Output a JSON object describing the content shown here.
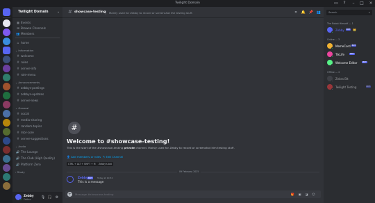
{
  "app": {
    "title": "Twilight Domain",
    "accent": "#5865f2"
  },
  "titlebar": {
    "icons": [
      "inbox-icon",
      "help-icon",
      "minimize-icon",
      "maximize-icon",
      "close-icon"
    ]
  },
  "sidebar": {
    "guild_name": "Twilight Domain",
    "nav": [
      {
        "icon": "calendar-icon",
        "label": "Events"
      },
      {
        "icon": "browse-icon",
        "label": "Browse Channels"
      },
      {
        "icon": "members-icon",
        "label": "Members"
      }
    ],
    "channels_top": [
      {
        "label": "home"
      }
    ],
    "categories": [
      {
        "label": "Information",
        "channels": [
          {
            "label": "welcome"
          },
          {
            "label": "rules"
          },
          {
            "label": "server-info"
          },
          {
            "label": "role-menu"
          }
        ]
      },
      {
        "label": "Announcements",
        "channels": [
          {
            "label": "zebbys-postings"
          },
          {
            "label": "zebbys-updates"
          },
          {
            "label": "server-news"
          }
        ]
      },
      {
        "label": "General",
        "channels": [
          {
            "label": "social"
          },
          {
            "label": "media-sharing"
          },
          {
            "label": "random-topics"
          },
          {
            "label": "mbr-core"
          },
          {
            "label": "server-suggestions"
          }
        ]
      },
      {
        "label": "Audio",
        "channels": [
          {
            "label": "The Lounge"
          },
          {
            "label": "The Club (High Quality)"
          },
          {
            "label": "Platform Zero"
          }
        ]
      },
      {
        "label": "Study",
        "channels": []
      }
    ]
  },
  "user": {
    "name": "Zebby",
    "status": "Online"
  },
  "channel": {
    "name": "showcase-testing",
    "topic": "Mainly used for Zebby to record or screenshot the testing stuff.",
    "welcome_title": "Welcome to #showcase-testing!",
    "welcome_pre": "This is the start of the #showcase-testing ",
    "welcome_bold": "private",
    "welcome_post": " channel. Mainly used for Zebby to record or screenshot him testing stuff.",
    "add_members": "Add members or roles",
    "edit_channel": "Edit Channel",
    "chips": [
      "CTRL + ALT + SHIFT + M",
      "Zebby's bot"
    ],
    "date_divider": "09 February 2025"
  },
  "message": {
    "author": "Zebby",
    "bot_tag": "BOT",
    "time": "Today at 10:34",
    "text": "This is a message"
  },
  "composer": {
    "placeholder": "Message #showcase-testing"
  },
  "search": {
    "placeholder": "Search"
  },
  "members": {
    "groups": [
      {
        "label": "The Robot Himself — 1",
        "items": [
          {
            "name": "Zebby",
            "badge": "BOT",
            "color": "#5865f2",
            "status": "#23a55a",
            "crown": "👑"
          }
        ]
      },
      {
        "label": "Online — 3",
        "items": [
          {
            "name": "MemeCord",
            "badge": "BOT",
            "color": "#f0b232",
            "status": "#23a55a"
          },
          {
            "name": "TikLife",
            "badge": "BOT",
            "color": "#eb459e",
            "status": "#23a55a"
          },
          {
            "name": "Welcome Editor",
            "badge": "BOT",
            "color": "#57f287",
            "status": "#23a55a"
          }
        ]
      },
      {
        "label": "Offline — 2",
        "items": [
          {
            "name": "Zebra Bit",
            "badge": "",
            "color": "#4e5058",
            "status": "#80848e"
          },
          {
            "name": "Twilight Testing",
            "badge": "BOT",
            "color": "#f23f43",
            "status": "#80848e"
          }
        ]
      }
    ]
  }
}
